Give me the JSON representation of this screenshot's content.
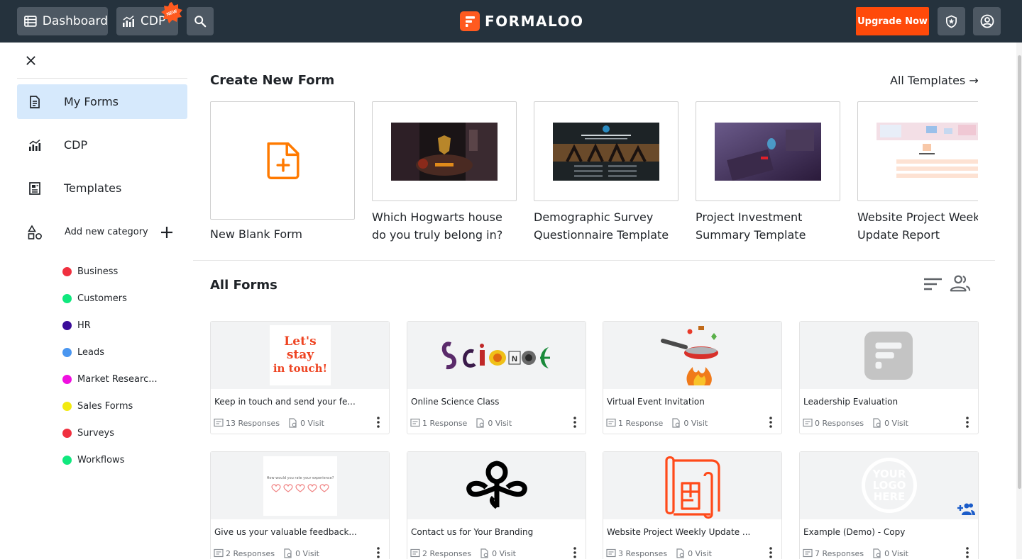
{
  "topbar": {
    "dashboard_label": "Dashboard",
    "cdp_label": "CDP",
    "new_badge": "NEW",
    "logo_text": "FORMALOO",
    "upgrade_label": "Upgrade Now"
  },
  "sidebar": {
    "items": [
      {
        "label": "My Forms",
        "icon": "form-document-icon",
        "active": true
      },
      {
        "label": "CDP",
        "icon": "analytics-chart-icon",
        "active": false
      },
      {
        "label": "Templates",
        "icon": "template-document-icon",
        "active": false
      }
    ],
    "add_category_label": "Add new category",
    "categories": [
      {
        "label": "Business",
        "color": "#f0303f"
      },
      {
        "label": "Customers",
        "color": "#10e87e"
      },
      {
        "label": "HR",
        "color": "#3b0d9a"
      },
      {
        "label": "Leads",
        "color": "#4a96f0"
      },
      {
        "label": "Market Researc...",
        "color": "#f010e0"
      },
      {
        "label": "Sales Forms",
        "color": "#f2ea10"
      },
      {
        "label": "Surveys",
        "color": "#f0303f"
      },
      {
        "label": "Workflows",
        "color": "#10e87e"
      }
    ]
  },
  "create_section": {
    "title": "Create New Form",
    "all_templates_label": "All Templates →",
    "templates": [
      {
        "title": "New Blank Form"
      },
      {
        "title": "Which Hogwarts house do you truly belong in?"
      },
      {
        "title": "Demographic Survey Questionnaire Template"
      },
      {
        "title": "Project Investment Summary Template"
      },
      {
        "title": "Website Project Weekly Update Report"
      }
    ]
  },
  "forms_section": {
    "title": "All Forms",
    "forms": [
      {
        "title": "Keep in touch and send your fe...",
        "responses": "13 Responses",
        "visits": "0 Visit",
        "thumb_text": [
          "Let's",
          "stay",
          "in touch!"
        ]
      },
      {
        "title": "Online Science Class",
        "responses": "1 Response",
        "visits": "0 Visit",
        "thumb_text": [
          "SCIENCE"
        ]
      },
      {
        "title": "Virtual Event Invitation",
        "responses": "1 Response",
        "visits": "0 Visit"
      },
      {
        "title": "Leadership Evaluation",
        "responses": "0 Responses",
        "visits": "0 Visit"
      },
      {
        "title": "Give us your valuable feedback...",
        "responses": "2 Responses",
        "visits": "0 Visit",
        "thumb_text": [
          "How would you rate your experience?"
        ]
      },
      {
        "title": "Contact us for Your Branding",
        "responses": "2 Responses",
        "visits": "0 Visit"
      },
      {
        "title": "Website Project Weekly Update ...",
        "responses": "3 Responses",
        "visits": "0 Visit"
      },
      {
        "title": "Example (Demo) - Copy",
        "responses": "7 Responses",
        "visits": "0 Visit",
        "thumb_text": [
          "YOUR",
          "LOGO",
          "HERE"
        ]
      }
    ]
  },
  "colors": {
    "accent": "#ff5a1f",
    "topbar": "#25323d",
    "active_nav": "#d6e9fc",
    "share": "#1b5cc9"
  }
}
